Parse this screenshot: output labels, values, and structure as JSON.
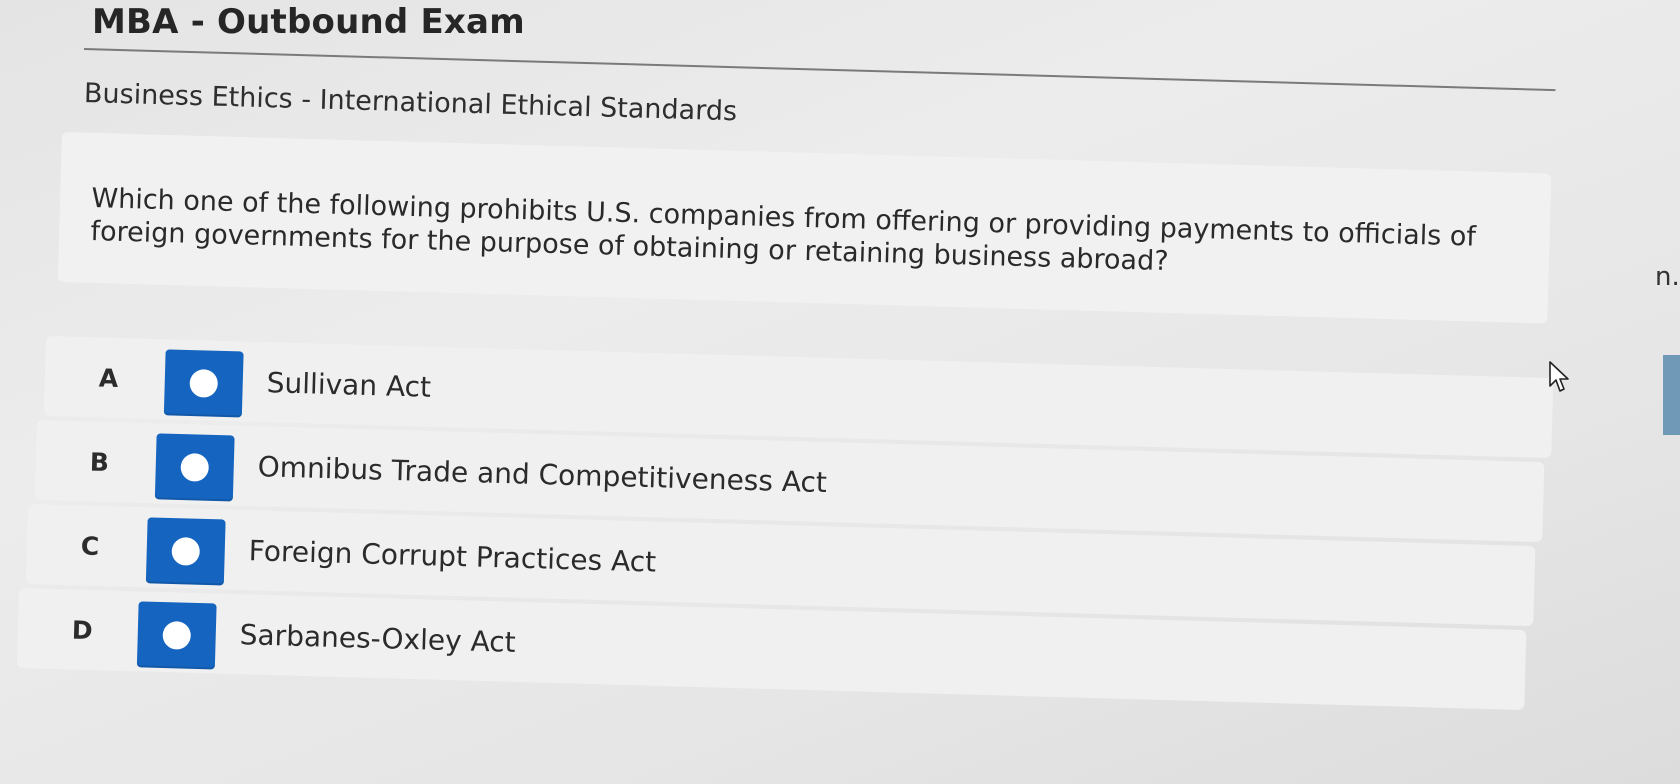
{
  "exam": {
    "title": "MBA - Outbound Exam",
    "subtitle": "Business Ethics - International Ethical Standards"
  },
  "question": {
    "text": "Which one of the following prohibits U.S. companies from offering or providing payments to officials of foreign governments for the purpose of obtaining or retaining business abroad?"
  },
  "options": [
    {
      "letter": "A",
      "label": "Sullivan Act",
      "selected": false
    },
    {
      "letter": "B",
      "label": "Omnibus Trade and Competitiveness Act",
      "selected": false
    },
    {
      "letter": "C",
      "label": "Foreign Corrupt Practices Act",
      "selected": false
    },
    {
      "letter": "D",
      "label": "Sarbanes-Oxley Act",
      "selected": false
    }
  ],
  "side": {
    "fragment_text": "n."
  },
  "colors": {
    "radio_fill": "#1565c0",
    "row_background": "#f0f0f0"
  },
  "icons": {
    "cursor": "mouse-pointer-icon",
    "radio": "radio-button-icon"
  }
}
